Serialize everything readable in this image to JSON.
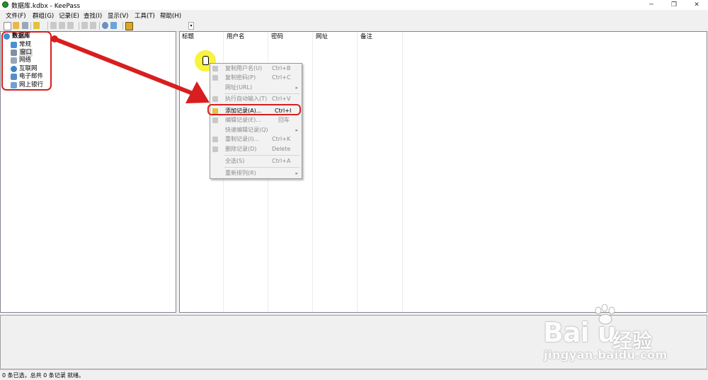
{
  "window": {
    "title": "数据库.kdbx - KeePass",
    "minimize": "─",
    "restore": "❐",
    "close": "✕"
  },
  "menubar": [
    "文件(F)",
    "群组(G)",
    "记录(E)",
    "查找(I)",
    "显示(V)",
    "工具(T)",
    "帮助(H)"
  ],
  "toolbar": {
    "combo_arrow": "▾"
  },
  "tree": {
    "root": "数据库",
    "groups": [
      "常规",
      "窗口",
      "网络",
      "互联网",
      "电子邮件",
      "网上银行"
    ],
    "selected": "窗口"
  },
  "list": {
    "columns": [
      "标题",
      "用户名",
      "密码",
      "网址",
      "备注"
    ]
  },
  "context_menu": {
    "items": [
      {
        "label": "复制用户名(U)",
        "shortcut": "Ctrl+B",
        "enabled": false
      },
      {
        "label": "复制密码(P)",
        "shortcut": "Ctrl+C",
        "enabled": false
      },
      {
        "label": "网址(URL)",
        "shortcut": "",
        "submenu": true,
        "enabled": false
      },
      {
        "label": "执行自动输入(T)",
        "shortcut": "Ctrl+V",
        "enabled": false
      },
      {
        "label": "添加记录(A)...",
        "shortcut": "Ctrl+I",
        "enabled": true
      },
      {
        "label": "编辑记录(E)...",
        "shortcut": "回车",
        "enabled": false
      },
      {
        "label": "快速编辑记录(Q)",
        "shortcut": "",
        "submenu": true,
        "enabled": false
      },
      {
        "label": "重制记录(I)...",
        "shortcut": "Ctrl+K",
        "enabled": false
      },
      {
        "label": "删除记录(D)",
        "shortcut": "Delete",
        "enabled": false
      },
      {
        "label": "全选(S)",
        "shortcut": "Ctrl+A",
        "enabled": false
      },
      {
        "label": "重新排列(R)",
        "shortcut": "",
        "submenu": true,
        "enabled": false
      }
    ],
    "submenu_arrow": "▸"
  },
  "status": {
    "left": "0 条已选，总共 0 条记录",
    "right": "就绪。"
  },
  "watermark": {
    "logo": "Bai  u",
    "brand": "经验",
    "url": "jingyan.baidu.com"
  },
  "colors": {
    "annotation": "#d81e1e",
    "cursor_highlight": "#f7f227"
  }
}
